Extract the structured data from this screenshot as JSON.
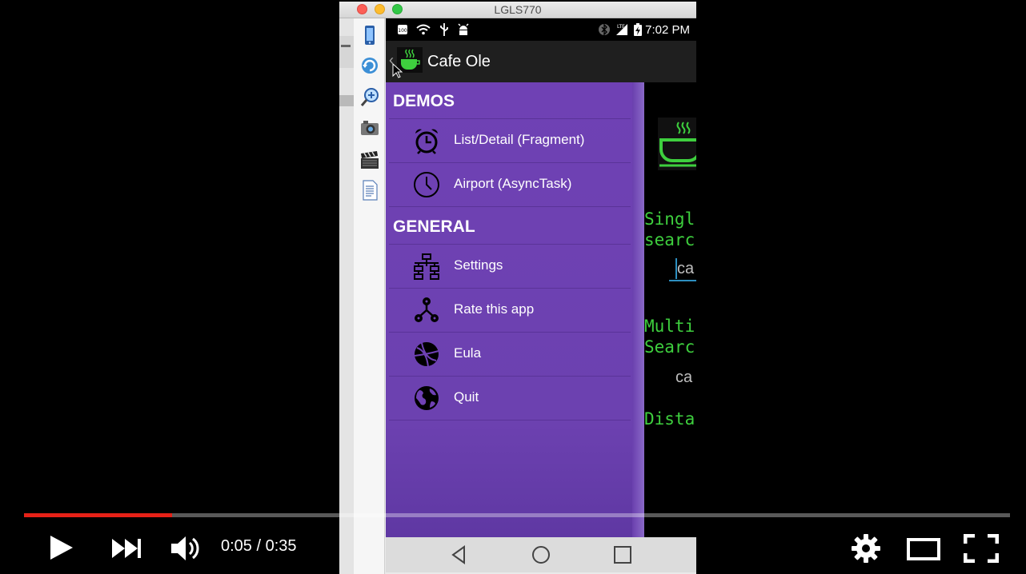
{
  "emulator": {
    "window_title": "LGLS770"
  },
  "status_bar": {
    "time": "7:02 PM"
  },
  "action_bar": {
    "title": "Cafe Ole"
  },
  "drawer": {
    "sections": [
      {
        "header": "DEMOS",
        "items": [
          {
            "label": "List/Detail (Fragment)",
            "icon": "alarm-clock-icon"
          },
          {
            "label": "Airport (AsyncTask)",
            "icon": "clock-icon"
          }
        ]
      },
      {
        "header": "GENERAL",
        "items": [
          {
            "label": "Settings",
            "icon": "network-tree-icon"
          },
          {
            "label": "Rate this app",
            "icon": "share-nodes-icon"
          },
          {
            "label": "Eula",
            "icon": "basketball-icon"
          },
          {
            "label": "Quit",
            "icon": "globe-icon"
          }
        ]
      }
    ]
  },
  "background_content": {
    "line1": "Singl",
    "line2": "searc",
    "input_value": "ca",
    "line3": "Multi",
    "line4": "Searc",
    "value2": "ca",
    "line5": "Dista"
  },
  "player": {
    "time_display": "0:05 / 0:35",
    "progress": 0.15,
    "colors": {
      "progress": "#e62117",
      "drawer": "#6f41b4",
      "accent_text": "#3ecf3e"
    }
  }
}
